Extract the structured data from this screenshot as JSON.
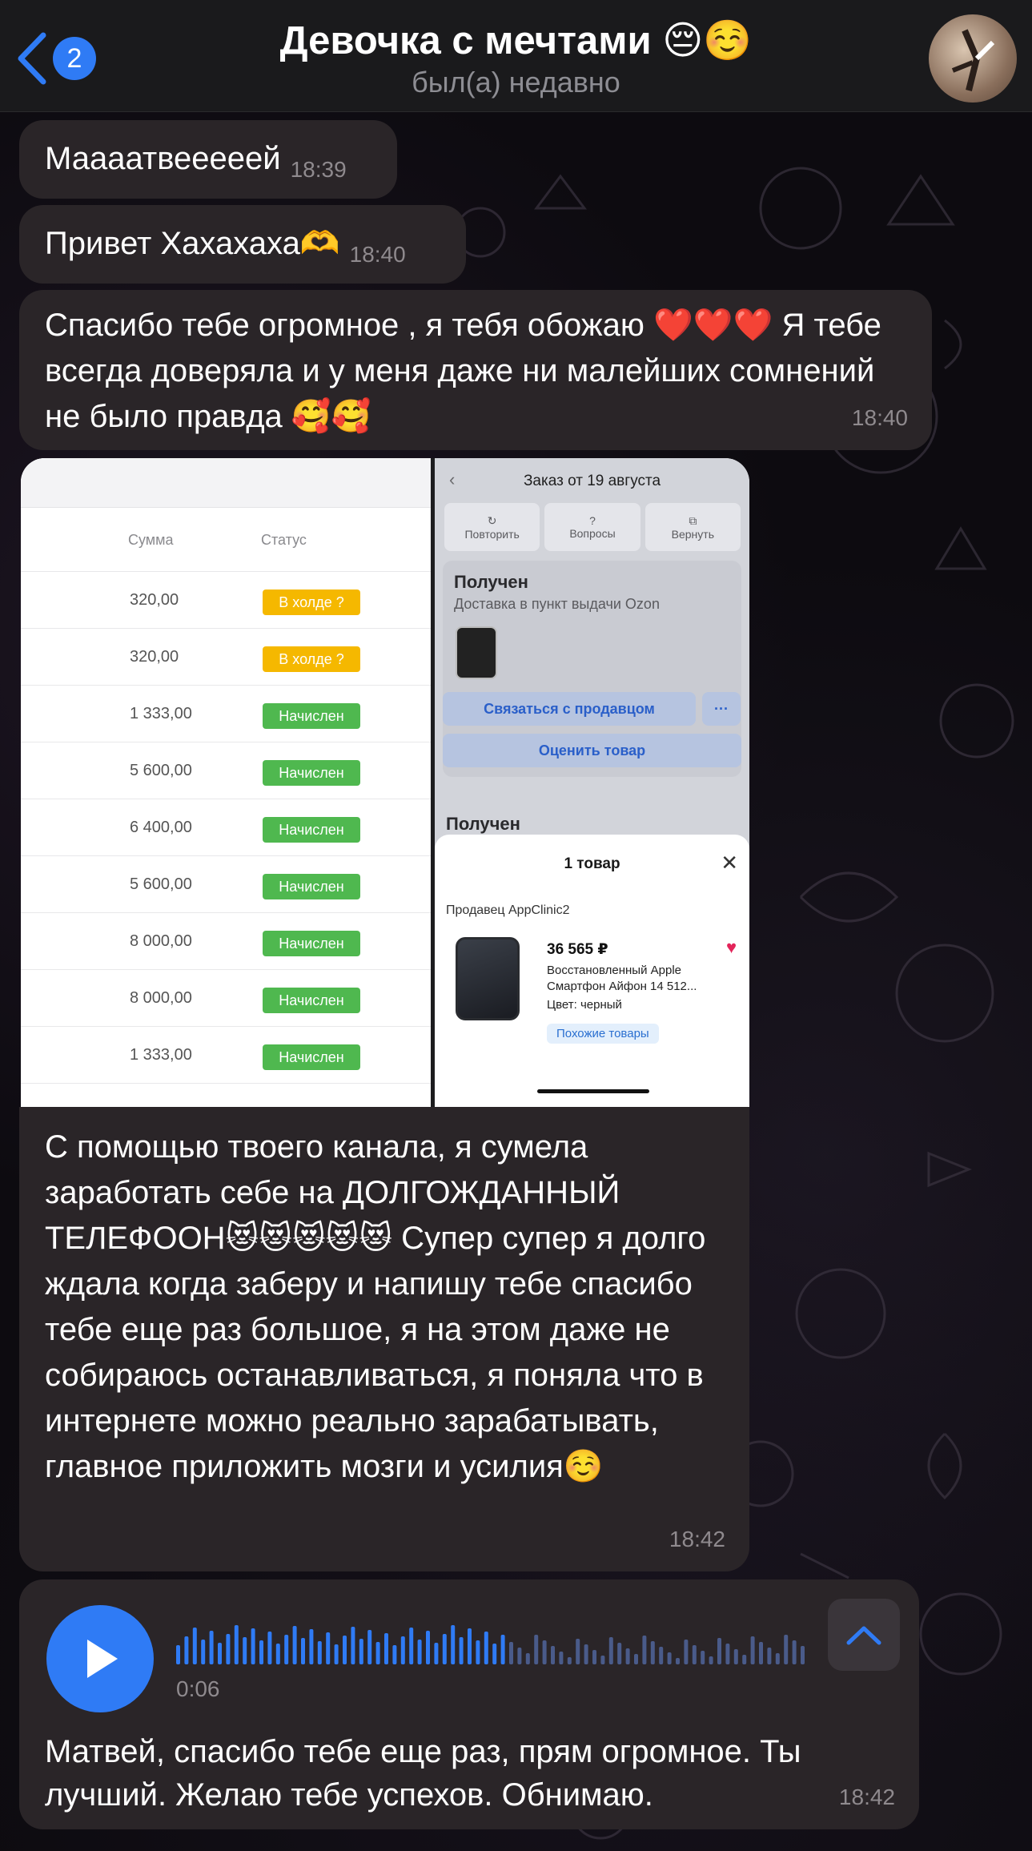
{
  "header": {
    "back_badge": "2",
    "title": "Девочка с мечтами 😔☺️",
    "status": "был(а) недавно"
  },
  "messages": [
    {
      "text": "Маааатвееееей",
      "time": "18:39"
    },
    {
      "text": "Привет Хахахаха🫶",
      "time": "18:40"
    },
    {
      "text": "Спасибо тебе огромное , я тебя обожаю ❤️❤️❤️ Я тебе всегда доверяла и у меня даже ни малейших сомнений не было правда 🥰🥰",
      "time": "18:40"
    }
  ],
  "screenshot_left": {
    "col_sum": "Сумма",
    "col_status": "Статус",
    "rows": [
      {
        "amount": "320,00",
        "status": "В холде ?",
        "kind": "hold"
      },
      {
        "amount": "320,00",
        "status": "В холде ?",
        "kind": "hold"
      },
      {
        "amount": "1 333,00",
        "status": "Начислен",
        "kind": "ok"
      },
      {
        "amount": "5 600,00",
        "status": "Начислен",
        "kind": "ok"
      },
      {
        "amount": "6 400,00",
        "status": "Начислен",
        "kind": "ok"
      },
      {
        "amount": "5 600,00",
        "status": "Начислен",
        "kind": "ok"
      },
      {
        "amount": "8 000,00",
        "status": "Начислен",
        "kind": "ok"
      },
      {
        "amount": "8 000,00",
        "status": "Начислен",
        "kind": "ok"
      },
      {
        "amount": "1 333,00",
        "status": "Начислен",
        "kind": "ok"
      }
    ]
  },
  "screenshot_right": {
    "title": "Заказ от 19 августа",
    "actions": [
      "Повторить",
      "Вопросы",
      "Вернуть"
    ],
    "received": "Получен",
    "delivery": "Доставка в пункт выдачи Ozon",
    "contact_seller": "Связаться с продавцом",
    "more": "···",
    "rate_product": "Оценить товар",
    "received2": "Получен",
    "sheet_title": "1 товар",
    "seller": "Продавец AppClinic2",
    "price": "36 565 ₽",
    "product": "Восстановленный Apple Смартфон Айфон 14 512...",
    "color": "Цвет: черный",
    "similar": "Похожие товары"
  },
  "caption": {
    "text": "С помощью твоего канала, я сумела заработать себе на ДОЛГОЖДАННЫЙ ТЕЛЕФООН😻😻😻😻😻 Супер супер я долго ждала когда заберу и напишу тебе спасибо тебе еще раз большое, я на этом даже не собираюсь останавливаться, я поняла что в интернете можно реально зарабатывать, главное приложить мозги и усилия☺️",
    "time": "18:42"
  },
  "voice": {
    "duration": "0:06",
    "transcript": "Матвей, спасибо тебе еще раз, прям огромное. Ты лучший. Желаю тебе успехов. Обнимаю.",
    "time": "18:42"
  },
  "colors": {
    "accent": "#2f7bf5",
    "bubble": "#2a2528",
    "hold": "#f5b800",
    "ok": "#4fb84f"
  }
}
